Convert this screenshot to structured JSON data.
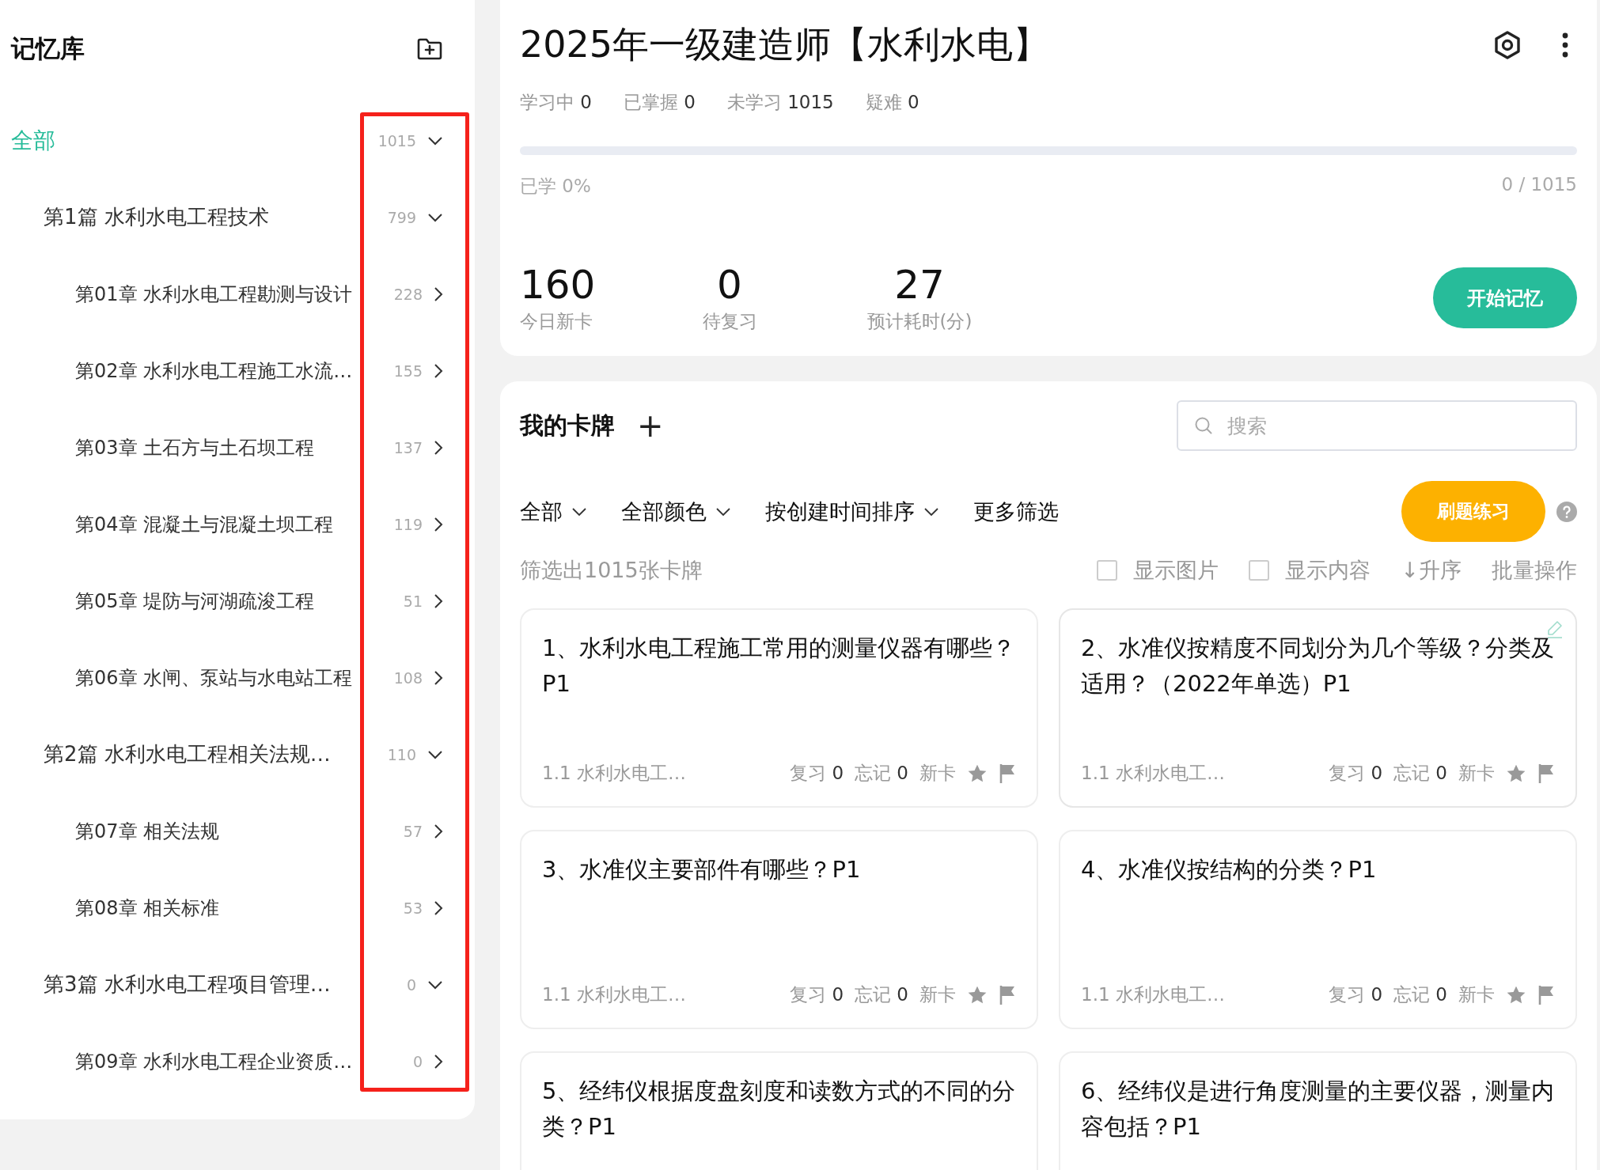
{
  "sidebar": {
    "title": "记忆库",
    "tree": [
      {
        "label": "全部",
        "count": "1015",
        "selected": true,
        "expanded": true,
        "children": [
          {
            "label": "第1篇 水利水电工程技术",
            "count": "799",
            "selected": false,
            "expanded": true,
            "children": [
              {
                "label": "第01章 水利水电工程勘测与设计",
                "count": "228",
                "selected": false,
                "expanded": false
              },
              {
                "label": "第02章 水利水电工程施工水流…",
                "count": "155",
                "selected": false,
                "expanded": false
              },
              {
                "label": "第03章 土石方与土石坝工程",
                "count": "137",
                "selected": false,
                "expanded": false
              },
              {
                "label": "第04章 混凝土与混凝土坝工程",
                "count": "119",
                "selected": false,
                "expanded": false
              },
              {
                "label": "第05章 堤防与河湖疏浚工程",
                "count": "51",
                "selected": false,
                "expanded": false
              },
              {
                "label": "第06章 水闸、泵站与水电站工程",
                "count": "108",
                "selected": false,
                "expanded": false
              }
            ]
          },
          {
            "label": "第2篇 水利水电工程相关法规…",
            "count": "110",
            "selected": false,
            "expanded": true,
            "children": [
              {
                "label": "第07章 相关法规",
                "count": "57",
                "selected": false,
                "expanded": false
              },
              {
                "label": "第08章 相关标准",
                "count": "53",
                "selected": false,
                "expanded": false
              }
            ]
          },
          {
            "label": "第3篇 水利水电工程项目管理…",
            "count": "0",
            "selected": false,
            "expanded": true,
            "children": [
              {
                "label": "第09章 水利水电工程企业资质…",
                "count": "0",
                "selected": false,
                "expanded": false
              }
            ]
          }
        ]
      }
    ]
  },
  "deck": {
    "title": "2025年一级建造师【水利水电】",
    "stats": [
      {
        "label": "学习中",
        "value": "0"
      },
      {
        "label": "已掌握",
        "value": "0"
      },
      {
        "label": "未学习",
        "value": "1015"
      },
      {
        "label": "疑难",
        "value": "0"
      }
    ],
    "progress": {
      "level": 0,
      "label": "已学 0%",
      "reading": "0 / 1015"
    },
    "metrics": [
      {
        "value": "160",
        "label": "今日新卡"
      },
      {
        "value": "0",
        "label": "待复习"
      },
      {
        "value": "27",
        "label": "预计耗时(分)"
      }
    ],
    "start_button": "开始记忆"
  },
  "cards_panel": {
    "title": "我的卡牌",
    "add": "+",
    "search": {
      "placeholder": "搜索"
    },
    "filters": [
      "全部",
      "全部颜色",
      "按创建时间排序"
    ],
    "more_filters": "更多筛选",
    "practice_button": "刷题练习",
    "result": "筛选出1015张卡牌",
    "options": [
      {
        "label": "显示图片",
        "checked": false
      },
      {
        "label": "显示内容",
        "checked": false
      }
    ],
    "sort": "↓升序",
    "batch": "批量操作",
    "cards": [
      {
        "title": "1、水利水电工程施工常用的测量仪器有哪些？P1",
        "editable": false,
        "footer": {
          "tag": "1.1 水利水电工…",
          "review": "复习",
          "review_count": "0",
          "forget": "忘记",
          "forget_count": "0",
          "status": "新卡"
        }
      },
      {
        "title": "2、水准仪按精度不同划分为几个等级？分类及适用？（2022年单选）P1",
        "editable": true,
        "footer": {
          "tag": "1.1 水利水电工…",
          "review": "复习",
          "review_count": "0",
          "forget": "忘记",
          "forget_count": "0",
          "status": "新卡"
        }
      },
      {
        "title": "3、水准仪主要部件有哪些？P1",
        "editable": false,
        "footer": {
          "tag": "1.1 水利水电工…",
          "review": "复习",
          "review_count": "0",
          "forget": "忘记",
          "forget_count": "0",
          "status": "新卡"
        }
      },
      {
        "title": "4、水准仪按结构的分类？P1",
        "editable": false,
        "footer": {
          "tag": "1.1 水利水电工…",
          "review": "复习",
          "review_count": "0",
          "forget": "忘记",
          "forget_count": "0",
          "status": "新卡"
        }
      },
      {
        "title": "5、经纬仪根据度盘刻度和读数方式的不同的分类？P1",
        "editable": false
      },
      {
        "title": "6、经纬仪是进行角度测量的主要仪器，测量内容包括？P1",
        "editable": false
      }
    ]
  }
}
